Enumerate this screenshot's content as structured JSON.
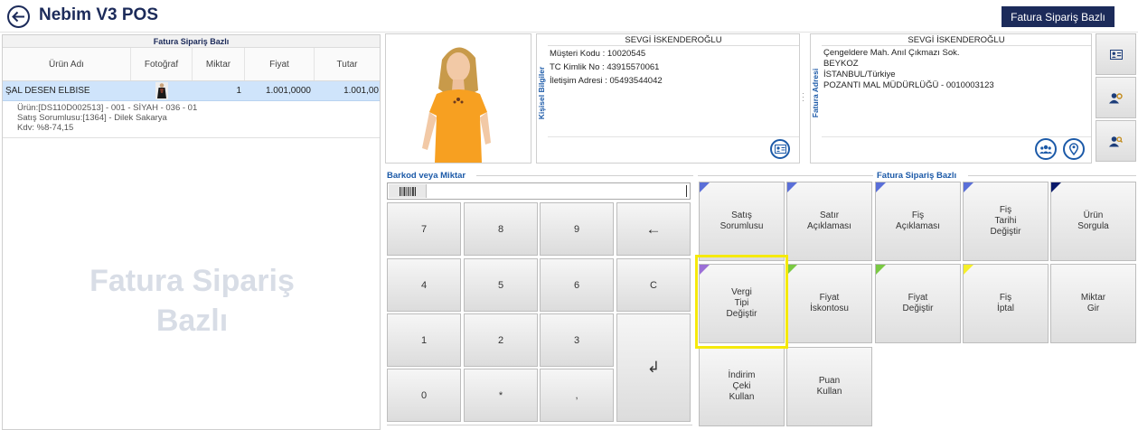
{
  "header": {
    "title": "Nebim V3 POS",
    "mode_button": "Fatura Sipariş Bazlı"
  },
  "grid": {
    "caption": "Fatura Sipariş Bazlı",
    "columns": [
      "Ürün Adı",
      "Fotoğraf",
      "Miktar",
      "Fiyat",
      "Tutar"
    ],
    "rows": [
      {
        "name": "ŞAL DESEN ELBISE",
        "qty": "1",
        "price": "1.001,0000",
        "total": "1.001,00",
        "detail1": "Ürün:[DS110D002513] - 001 - SİYAH - 036 - 01",
        "detail2": "Satış Sorumlusu:[1364] - Dilek Sakarya",
        "detail3": "Kdv: %8-74,15"
      }
    ],
    "watermark_line1": "Fatura Sipariş",
    "watermark_line2": "Bazlı"
  },
  "customer": {
    "tab_label": "Kişisel Bilgiler",
    "name": "SEVGİ İSKENDEROĞLU",
    "line1": "Müşteri Kodu  :  10020545",
    "line2": "TC Kimlik No  :  43915570061",
    "line3": "İletişim Adresi  :  05493544042"
  },
  "address": {
    "tab_label": "Fatura Adresi",
    "name": "SEVGİ İSKENDEROĞLU",
    "line1": "Çengeldere Mah. Anıl Çıkmazı Sok.",
    "line2": "BEYKOZ",
    "line3": "İSTANBUL/Türkiye",
    "line4": "POZANTI MAL MÜDÜRLÜĞÜ - 0010003123"
  },
  "barcode": {
    "caption": "Barkod veya Miktar",
    "value": ""
  },
  "keypad": {
    "k7": "7",
    "k8": "8",
    "k9": "9",
    "back": "←",
    "k4": "4",
    "k5": "5",
    "k6": "6",
    "clear": "C",
    "k1": "1",
    "k2": "2",
    "k3": "3",
    "enter": "↲",
    "k0": "0",
    "star": "*",
    "comma": ","
  },
  "functions": {
    "caption": "Fatura Sipariş Bazlı",
    "satis_sorumlusu": "Satış\nSorumlusu",
    "satir_aciklamasi": "Satır\nAçıklaması",
    "fis_aciklamasi": "Fiş\nAçıklaması",
    "fis_tarihi": "Fiş\nTarihi\nDeğiştir",
    "urun_sorgula": "Ürün\nSorgula",
    "vergi_tipi": "Vergi\nTipi\nDeğiştir",
    "fiyat_iskontosu": "Fiyat\nİskontosu",
    "fiyat_degistir": "Fiyat\nDeğiştir",
    "fis_iptal": "Fiş\nİptal",
    "miktar_gir": "Miktar\nGir",
    "indirim_ceki": "İndirim\nÇeki\nKullan",
    "puan_kullan": "Puan\nKullan"
  },
  "colors": {
    "brand": "#1c2b5a",
    "accent": "#1c5aa8",
    "selection": "#cfe4fb",
    "highlight": "#f5e90c",
    "corner_blue": "#5a6fd8",
    "corner_navy": "#0a1a6a",
    "corner_purple": "#9b6fd6",
    "corner_green": "#7ac943",
    "corner_yellow": "#f5ef2a"
  }
}
